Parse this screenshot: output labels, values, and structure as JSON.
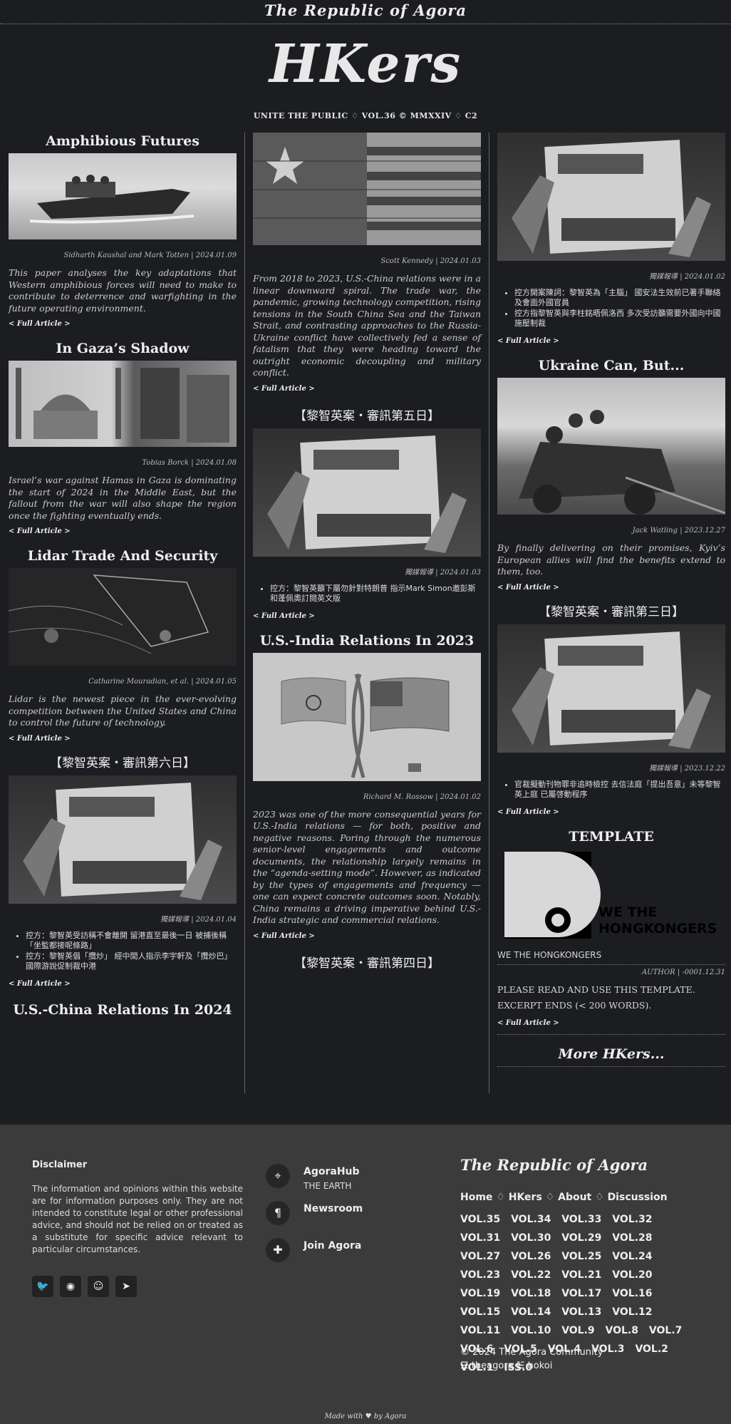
{
  "top_title": "The Republic of Agora",
  "logo": "HKers",
  "subline": "UNITE THE PUBLIC ♢ VOL.36 © MMXXIV ♢ C2",
  "full_label": "< Full Article >",
  "col1": [
    {
      "title": "Amphibious Futures",
      "meta": "Sidharth Kaushal and Mark Totten | 2024.01.09",
      "excerpt": "This paper analyses the key adaptations that Western amphibious forces will need to make to contribute to deterrence and warfighting in the future operating environment.",
      "image": "speedboat-photo"
    },
    {
      "title": "In Gaza’s Shadow",
      "meta": "Tobias Borck | 2024.01.08",
      "excerpt": "Israel’s war against Hamas in Gaza is dominating the start of 2024 in the Middle East, but the fallout from the war will also shape the region once the fighting eventually ends.",
      "image": "mosque-ruins-photo"
    },
    {
      "title": "Lidar Trade And Security",
      "meta": "Catharine Mouradian, et al. | 2024.01.05",
      "excerpt": "Lidar is the newest piece in the ever-evolving competition between the United States and China to control the future of technology.",
      "image": "lidar-pointcloud-image"
    },
    {
      "title": "【黎智英案・審訊第六日】",
      "meta": "獨媒報導 | 2024.01.04",
      "bullets": [
        "控方：黎智英受訪稱不會離開 留港直至最後一日 被捕後稱「坐監都接呢條路」",
        "控方：黎智英倡「攬炒」 經中間人指示李宇軒及「攬炒巴」國際游說促制裁中港"
      ],
      "image": "newspaper-protest-photo"
    },
    {
      "title": "U.S.-China Relations In 2024"
    }
  ],
  "col2": [
    {
      "meta": "Scott Kennedy | 2024.01.03",
      "excerpt": "From 2018 to 2023, U.S.-China relations were in a linear downward spiral. The trade war, the pandemic, growing technology competition, rising tensions in the South China Sea and the Taiwan Strait, and contrasting approaches to the Russia-Ukraine conflict have collectively fed a sense of fatalism that they were heading toward the outright economic decoupling and military conflict.",
      "image": "flags-brick-wall-photo"
    },
    {
      "title": "【黎智英案・審訊第五日】",
      "meta": "獨媒報導 | 2024.01.03",
      "bullets": [
        "控方：黎智英籲下屬勿針對特朗普 指示Mark Simon邀彭斯和蓬佩奧訂閱英文版"
      ],
      "image": "newspaper-protest-photo"
    },
    {
      "title": "U.S.-India Relations In 2023",
      "meta": "Richard M. Rossow | 2024.01.02",
      "excerpt": "2023 was one of the more consequential years for U.S.-India relations — for both, positive and negative reasons. Poring through the numerous senior-level engagements and outcome documents, the relationship largely remains in the “agenda-setting mode”. However, as indicated by the types of engagements and frequency — one can expect concrete outcomes soon. Notably, China remains a driving imperative behind U.S.-India strategic and commercial relations.",
      "image": "india-us-flags-illustration"
    },
    {
      "title": "【黎智英案・審訊第四日】"
    }
  ],
  "col3": [
    {
      "meta": "獨媒報導 | 2024.01.02",
      "bullets": [
        "控方開案陳詞：黎智英為「主腦」 國安法生效前已著手聯絡及會面外國官員",
        "控方指黎智英與李柱銘晤佩洛西 多次受訪籲需要外國向中國施壓制裁"
      ],
      "image": "newspaper-protest-photo"
    },
    {
      "title": "Ukraine Can, But...",
      "meta": "Jack Watling | 2023.12.27",
      "excerpt": "By finally delivering on their promises, Kyiv’s European allies will find the benefits extend to them, too.",
      "image": "soldiers-vehicle-photo"
    },
    {
      "title": "【黎智英案・審訊第三日】",
      "meta": "獨媒報導 | 2023.12.22",
      "bullets": [
        "官裁擬動刊物罪非追時檢控 去信法庭「提出吾意」未等黎智英上庭 已屬啓動程序"
      ],
      "image": "newspaper-protest-photo"
    },
    {
      "title": "TEMPLATE",
      "caption": "WE THE HONGKONGERS",
      "meta": "AUTHOR | -0001.12.31",
      "lines": [
        "PLEASE READ AND USE THIS TEMPLATE.",
        "EXCERPT ENDS (< 200 WORDS)."
      ],
      "image_text": [
        "WE THE",
        "HONGKONGERS"
      ]
    }
  ],
  "more": "More HKers...",
  "footer": {
    "disclaimer_title": "Disclaimer",
    "disclaimer_text": "The information and opinions within this website are for information purposes only. They are not intended to constitute legal or other professional advice, and should not be relied on or treated as a substitute for specific advice relevant to particular circumstances.",
    "social": [
      "twitter-icon",
      "github-icon",
      "reddit-icon",
      "telegram-icon"
    ],
    "hub": [
      {
        "name": "AgoraHub",
        "sub": "THE EARTH",
        "icon": "location-pin-icon"
      },
      {
        "name": "Newsroom",
        "icon": "paragraph-icon"
      },
      {
        "name": "Join Agora",
        "icon": "puzzle-icon"
      }
    ],
    "republic": "The Republic of Agora",
    "nav": [
      "Home",
      "HKers",
      "About",
      "Discussion"
    ],
    "vols": [
      "VOL.35",
      "VOL.34",
      "VOL.33",
      "VOL.32",
      "VOL.31",
      "VOL.30",
      "VOL.29",
      "VOL.28",
      "VOL.27",
      "VOL.26",
      "VOL.25",
      "VOL.24",
      "VOL.23",
      "VOL.22",
      "VOL.21",
      "VOL.20",
      "VOL.19",
      "VOL.18",
      "VOL.17",
      "VOL.16",
      "VOL.15",
      "VOL.14",
      "VOL.13",
      "VOL.12",
      "VOL.11",
      "VOL.10",
      "VOL.9",
      "VOL.8",
      "VOL.7",
      "VOL.6",
      "VOL.5",
      "VOL.4",
      "VOL.3",
      "VOL.2",
      "VOL.1",
      "ISS.0"
    ],
    "copyright": "© 2024 The Agora Community",
    "links": "☰ theagora ☱ hokoi"
  },
  "made_with": "Made with ♥ by Agora"
}
